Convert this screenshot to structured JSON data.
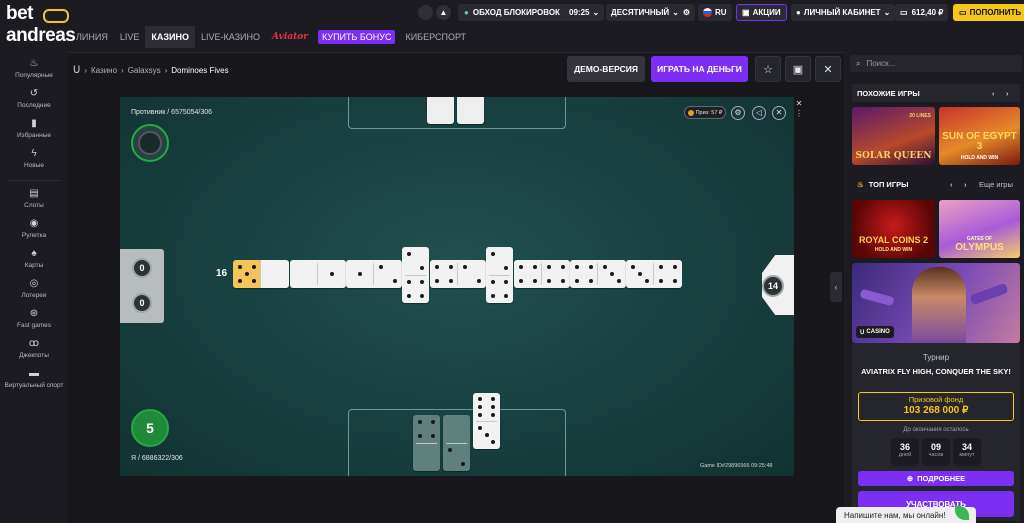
{
  "brand": {
    "line1": "bet",
    "line2": "andreas"
  },
  "nav": [
    "ЛИНИЯ",
    "LIVE",
    "КАЗИНО",
    "LIVE-КАЗИНО",
    "Aviator",
    "КУПИТЬ БОНУС",
    "КИБЕРСПОРТ"
  ],
  "topbar": {
    "bypass": "ОБХОД БЛОКИРОВОК",
    "time": "09:25",
    "odds_format": "ДЕСЯТИЧНЫЙ",
    "lang": "RU",
    "promos": "АКЦИИ",
    "cabinet": "ЛИЧНЫЙ КАБИНЕТ",
    "balance": "612,40 ₽",
    "deposit": "ПОПОЛНИТЬ"
  },
  "sidebar": [
    "Популярные",
    "Последние",
    "Избранные",
    "Новые",
    "Слоты",
    "Рулетка",
    "Карты",
    "Лотереи",
    "Fast games",
    "Джекпоты",
    "Виртуальный спорт"
  ],
  "breadcrumbs": [
    "Казино",
    "Galaxsys",
    "Dominoes Fives"
  ],
  "buttons": {
    "demo": "ДЕМО-ВЕРСИЯ",
    "real": "ИГРАТЬ НА ДЕНЬГИ"
  },
  "game": {
    "opponent": "Противник / 6575054/306",
    "player": "Я / 6886322/306",
    "prize_badge": "Приз: 57 ₽",
    "left_scores": [
      "0",
      "0"
    ],
    "board_score": "16",
    "right_count": "14",
    "player_score": "5",
    "footer": "Game ID#29896566   09:25:48"
  },
  "right": {
    "search_placeholder": "Поиск...",
    "similar": "ПОХОЖИЕ ИГРЫ",
    "top": "ТОП ИГРЫ",
    "more": "Еще игры",
    "games": [
      {
        "name": "SOLAR QUEEN",
        "sub": "20 LINES"
      },
      {
        "name": "SUN OF EGYPT 3",
        "sub": "HOLD AND WIN"
      },
      {
        "name": "ROYAL COINS 2",
        "sub": "HOLD AND WIN"
      },
      {
        "name": "OLYMPUS",
        "sub": "GATES OF"
      }
    ],
    "promo_tag": "CASINO",
    "tournament_label": "Турнир",
    "tournament_name": "AVIATRIX FLY HIGH, CONQUER THE SKY!",
    "prize_label": "Призовой фонд",
    "prize_value": "103 268 000 ₽",
    "until_end": "До окончания осталось",
    "countdown": [
      {
        "v": "36",
        "u": "дней"
      },
      {
        "v": "09",
        "u": "часов"
      },
      {
        "v": "34",
        "u": "минут"
      }
    ],
    "details": "ПОДРОБНЕЕ",
    "join": "УЧАСТВОВАТЬ"
  },
  "chat": "Напишите нам, мы онлайн!",
  "colors": {
    "accent": "#7b2ff2",
    "brand_yellow": "#f5c71a",
    "felt": "#17403f",
    "green_ring": "#28a745"
  }
}
